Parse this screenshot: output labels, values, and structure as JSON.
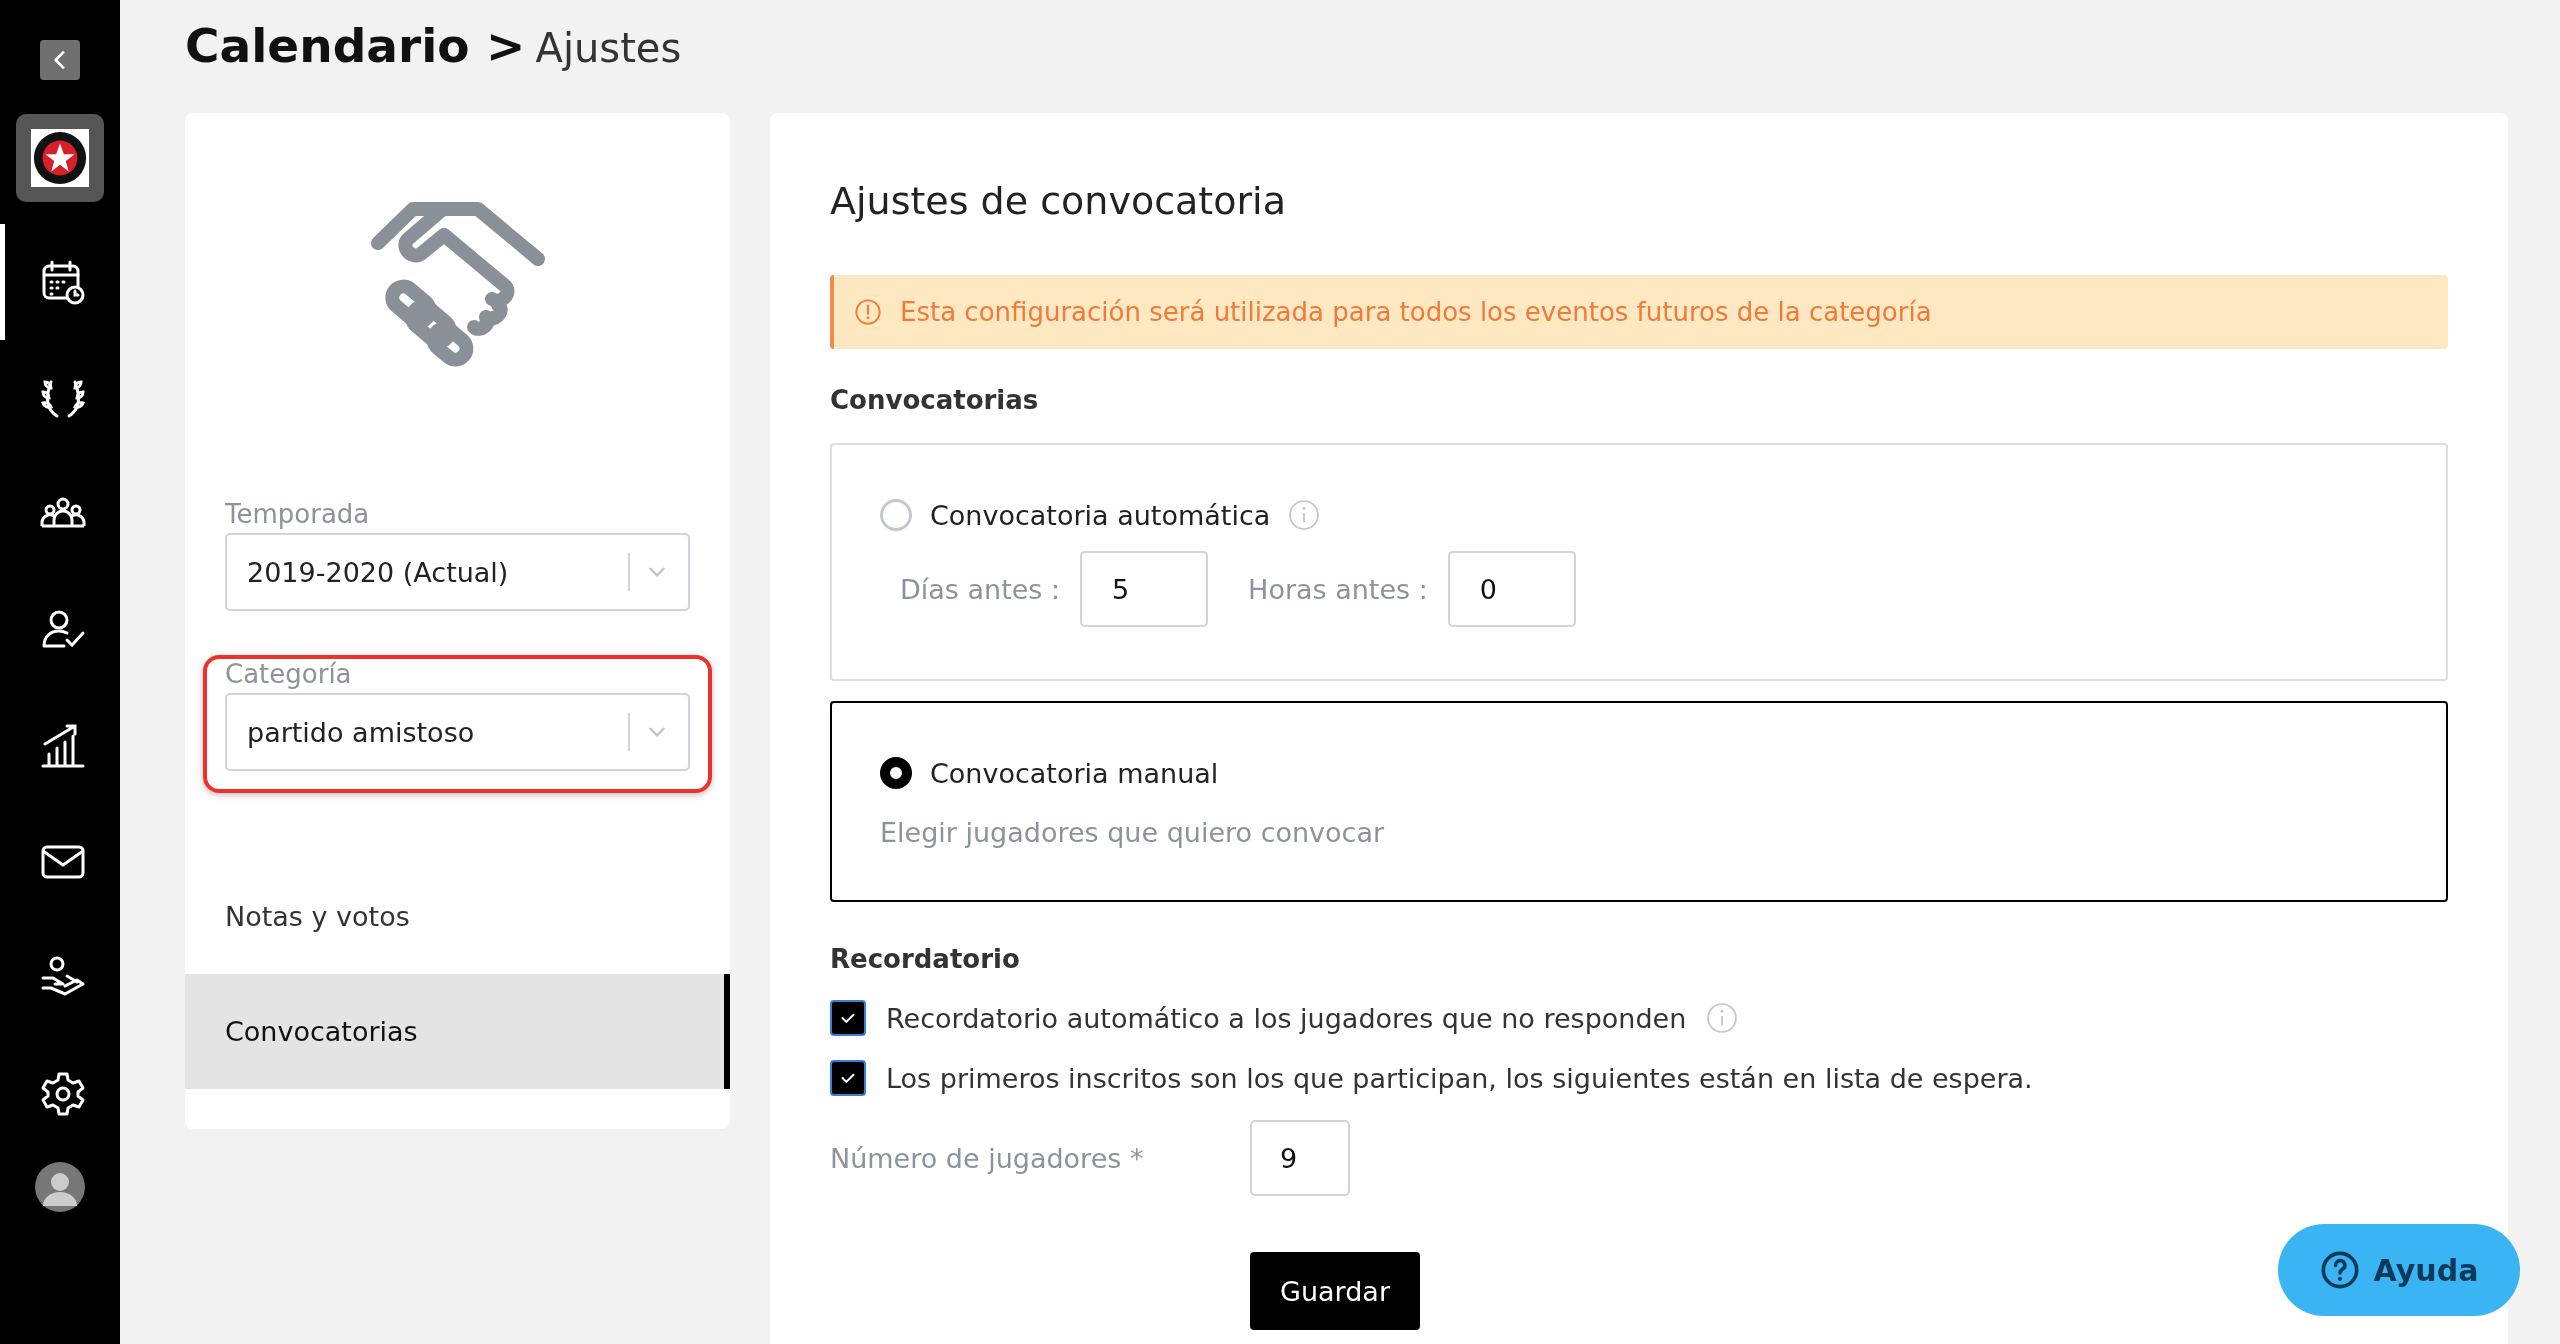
{
  "nav": [
    {
      "kind": "calendar",
      "selected": true
    },
    {
      "kind": "laurel",
      "selected": false
    },
    {
      "kind": "team",
      "selected": false
    },
    {
      "kind": "user-check",
      "selected": false
    },
    {
      "kind": "stats",
      "selected": false
    },
    {
      "kind": "mail",
      "selected": false
    },
    {
      "kind": "hand",
      "selected": false
    },
    {
      "kind": "settings",
      "selected": false
    }
  ],
  "breadcrumb": {
    "section": "Calendario >",
    "page": "Ajustes"
  },
  "left_panel": {
    "selects": [
      {
        "label": "Temporada",
        "value": "2019-2020 (Actual)",
        "highlighted": false
      },
      {
        "label": "Categoría",
        "value": "partido amistoso",
        "highlighted": true
      }
    ],
    "menu": [
      {
        "label": "Notas y votos",
        "selected": false
      },
      {
        "label": "Convocatorias",
        "selected": true
      }
    ]
  },
  "main": {
    "title": "Ajustes de convocatoria",
    "alert": "Esta configuración será utilizada para todos los eventos futuros de la categoría",
    "section": "Convocatorias",
    "options": [
      {
        "kind": "auto",
        "label": "Convocatoria automática",
        "selected": false,
        "fields": [
          {
            "label": "Días antes :",
            "value": "5"
          },
          {
            "label": "Horas antes :",
            "value": "0"
          }
        ]
      },
      {
        "kind": "manual",
        "label": "Convocatoria manual",
        "selected": true,
        "description": "Elegir jugadores que quiero convocar"
      }
    ],
    "reminder_title": "Recordatorio",
    "checks": [
      {
        "label": "Recordatorio automático a los jugadores que no responden",
        "checked": true,
        "info": true
      },
      {
        "label": "Los primeros inscritos son los que participan, los siguientes están en lista de espera.",
        "checked": true,
        "info": false
      }
    ],
    "player_count": {
      "label": "Número de jugadores *",
      "value": "9"
    },
    "save": "Guardar"
  },
  "help": "Ayuda"
}
